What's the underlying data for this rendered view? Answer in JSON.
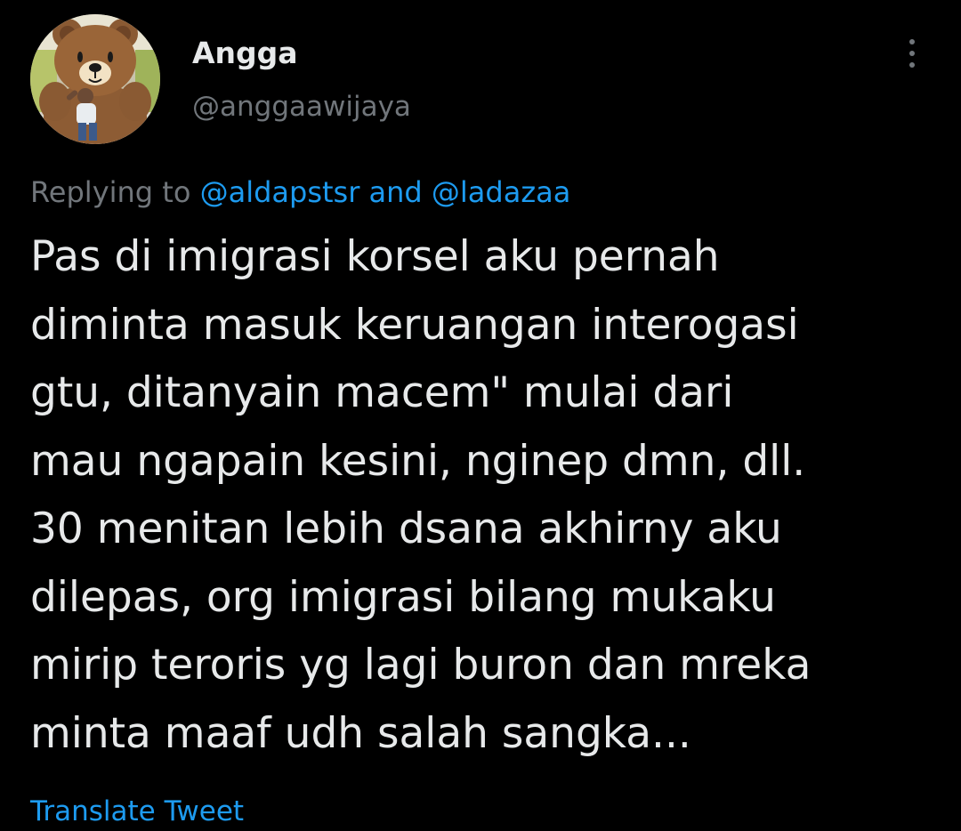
{
  "author": {
    "display_name": "Angga",
    "handle": "@anggaawijaya",
    "avatar_icon": "avatar-photo-brown-bear-plush"
  },
  "more_icon": "vertical-ellipsis-icon",
  "reply_context": {
    "prefix": "Replying to",
    "mention_1": "@aldapstsr",
    "joiner": "and",
    "mention_2": "@ladazaa"
  },
  "tweet": {
    "lines": [
      "Pas di imigrasi korsel aku pernah",
      "diminta masuk keruangan interogasi",
      "gtu, ditanyain macem\" mulai dari",
      "mau ngapain kesini, nginep dmn, dll.",
      "30 menitan lebih dsana akhirny aku",
      "dilepas, org imigrasi bilang mukaku",
      "mirip teroris yg lagi buron dan mreka",
      "minta maaf udh salah sangka..."
    ]
  },
  "translate_label": "Translate Tweet",
  "colors": {
    "background": "#000000",
    "primary_text": "#e7e9ea",
    "secondary_text": "#71767b",
    "link": "#1d9bf0"
  }
}
